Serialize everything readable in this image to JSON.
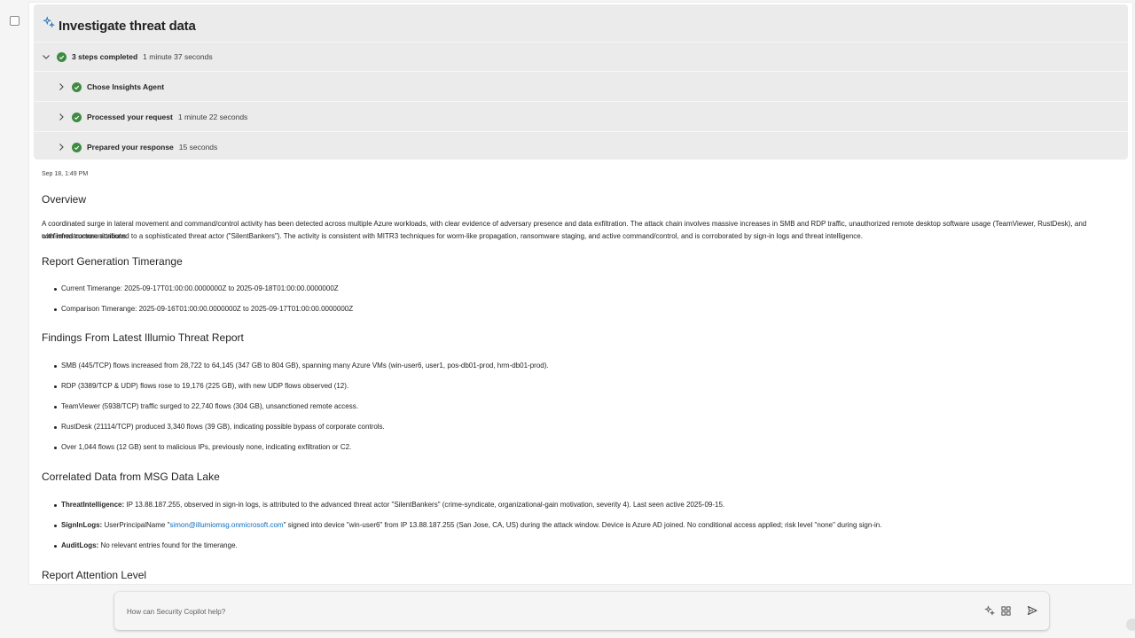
{
  "card": {
    "title": "Investigate threat data",
    "summary": {
      "label": "3 steps completed",
      "time": "1 minute 37 seconds"
    },
    "steps": [
      {
        "label": "Chose Insights Agent",
        "time": ""
      },
      {
        "label": "Processed your request",
        "time": "1 minute 22 seconds"
      },
      {
        "label": "Prepared your response",
        "time": "15 seconds"
      }
    ]
  },
  "timestamp": "Sep 18, 1:49 PM",
  "report": {
    "overview_heading": "Overview",
    "overview_line1": "A coordinated surge in lateral movement and command/control activity has been detected across multiple Azure workloads, with clear evidence of adversary presence and data exfiltration. The attack chain involves massive increases in SMB and RDP traffic, unauthorized remote desktop software usage (TeamViewer, RustDesk), and confirmed communications",
    "overview_line2": "with infrastructure attributed to a sophisticated threat actor (\"SilentBankers\"). The activity is consistent with MITR3 techniques for worm-like propagation, ransomware staging, and active command/control, and is corroborated by sign-in logs and threat intelligence.",
    "timerange_heading": "Report Generation Timerange",
    "timerange_items": [
      "Current Timerange: 2025-09-17T01:00:00.0000000Z to 2025-09-18T01:00:00.0000000Z",
      "Comparison Timerange: 2025-09-16T01:00:00.0000000Z to 2025-09-17T01:00:00.0000000Z"
    ],
    "findings_heading": "Findings From Latest Illumio Threat Report",
    "findings_items": [
      "SMB (445/TCP) flows increased from 28,722 to 64,145 (347 GB to 804 GB), spanning many Azure VMs (win-user6, user1, pos-db01-prod, hrm-db01-prod).",
      "RDP (3389/TCP & UDP) flows rose to 19,176 (225 GB), with new UDP flows observed (12).",
      "TeamViewer (5938/TCP) traffic surged to 22,740 flows (304 GB), unsanctioned remote access.",
      "RustDesk (21114/TCP) produced 3,340 flows (39 GB), indicating possible bypass of corporate controls.",
      "Over 1,044 flows (12 GB) sent to malicious IPs, previously none, indicating exfiltration or C2."
    ],
    "correlated_heading": "Correlated Data from MSG Data Lake",
    "correlated": {
      "threat_label": "ThreatIntelligence:",
      "threat_text": " IP 13.88.187.255, observed in sign-in logs, is attributed to the advanced threat actor \"SilentBankers\" (crime-syndicate, organizational-gain motivation, severity 4). Last seen active 2025-09-15.",
      "signin_label": "SignInLogs:",
      "signin_pre": " UserPrincipalName \"",
      "signin_link": "simon@illumiomsg.onmicrosoft.com",
      "signin_post": "\" signed into device \"win-user6\" from IP 13.88.187.255 (San Jose, CA, US) during the attack window. Device is Azure AD joined. No conditional access applied; risk level \"none\" during sign-in.",
      "audit_label": "AuditLogs:",
      "audit_text": " No relevant entries found for the timerange."
    },
    "attention_heading": "Report Attention Level"
  },
  "composer": {
    "placeholder": "How can Security Copilot help?"
  },
  "colors": {
    "accent": "#0f6cbd",
    "success": "#3d8b40",
    "card_bg": "#ebebeb"
  },
  "icons": {
    "title": "sparkle-icon",
    "expand": "chevron-icon",
    "status": "checkmark-icon",
    "prompts": "sparkle-icon",
    "plugins": "grid-icon",
    "send": "send-icon"
  }
}
